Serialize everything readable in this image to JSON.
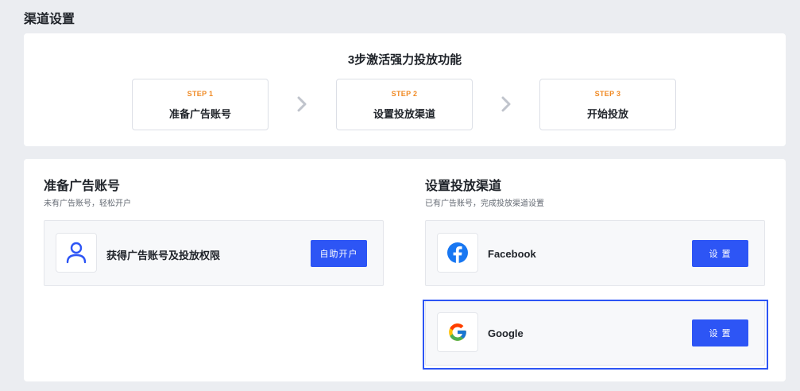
{
  "page": {
    "title": "渠道设置"
  },
  "steps": {
    "title": "3步激活强力投放功能",
    "items": [
      {
        "num": "STEP 1",
        "label": "准备广告账号"
      },
      {
        "num": "STEP 2",
        "label": "设置投放渠道"
      },
      {
        "num": "STEP 3",
        "label": "开始投放"
      }
    ]
  },
  "account": {
    "title": "准备广告账号",
    "subtitle": "未有广告账号，轻松开户",
    "row": {
      "label": "获得广告账号及投放权限",
      "button": "自助开户",
      "icon": "user-icon"
    }
  },
  "channels": {
    "title": "设置投放渠道",
    "subtitle": "已有广告账号，完成投放渠道设置",
    "items": [
      {
        "label": "Facebook",
        "button": "设 置",
        "icon": "facebook-icon"
      },
      {
        "label": "Google",
        "button": "设 置",
        "icon": "google-icon",
        "selected": true
      }
    ]
  },
  "colors": {
    "accent": "#2d55f5",
    "step_num": "#f08a24",
    "background": "#ebedf1",
    "facebook": "#1877f2"
  }
}
